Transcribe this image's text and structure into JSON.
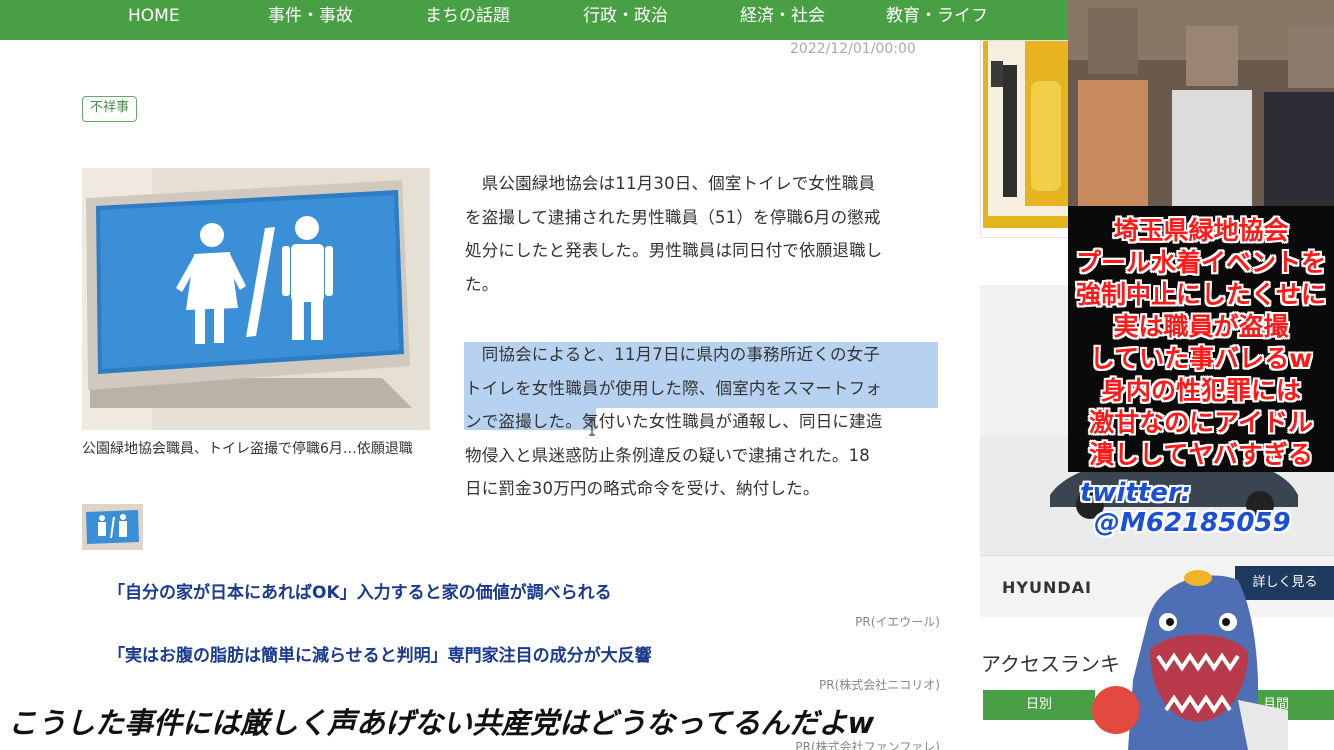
{
  "nav": {
    "items": [
      "HOME",
      "事件・事故",
      "まちの話題",
      "行政・政治",
      "経済・社会",
      "教育・ライフ"
    ]
  },
  "article": {
    "date": "2022/12/01/00:00",
    "tag": "不祥事",
    "caption": "公園緑地協会職員、トイレ盗撮で停職6月…依願退職",
    "paragraphs": [
      [
        "　県公園緑地協会は11月30日、個室トイレで女性職員",
        "を盗撮して逮捕された男性職員（51）を停職6月の懲戒",
        "処分にしたと発表した。男性職員は同日付で依願退職し",
        "た。"
      ],
      [
        "　同協会によると、11月7日に県内の事務所近くの女子",
        "トイレを女性職員が使用した際、個室内をスマートフォ",
        "ンで盗撮した。気付いた女性職員が通報し、同日に建造",
        "物侵入と県迷惑防止条例違反の疑いで逮捕された。18",
        "日に罰金30万円の略式命令を受け、納付した。"
      ]
    ]
  },
  "promos": [
    {
      "title": "「自分の家が日本にあればOK」入力すると家の価値が調べられる",
      "source": "PR(イエウール)"
    },
    {
      "title": "「実はお腹の脂肪は簡単に減らせると判明」専門家注目の成分が大反響",
      "source": "PR(株式会社ニコリオ)"
    },
    {
      "title": "",
      "source": "PR(株式会社ファンファレ)"
    }
  ],
  "sidebar": {
    "ad_brand": "HYUNDAI",
    "ad_button": "詳しく見る",
    "ranking_title": "アクセスランキ",
    "tabs": [
      "日別",
      "月間"
    ]
  },
  "overlay": {
    "lines": [
      "埼玉県緑地協会",
      "プール水着イベントを",
      "強制中止にしたくせに",
      "実は職員が盗撮",
      "していた事バレるw",
      "身内の性犯罪には",
      "激甘なのにアイドル",
      "潰ししてヤバすぎる"
    ],
    "twitter_label": "twitter:",
    "twitter_handle": "@M62185059",
    "subtitle": "こうした事件には厳しく声あげない共産党はどうなってるんだよw"
  },
  "colors": {
    "nav_green": "#49a044",
    "promo_blue": "#1a3a8c",
    "highlight": "#b7d2f0",
    "overlay_red": "#ff1a1a",
    "twitter_blue": "#1b4fd6"
  }
}
